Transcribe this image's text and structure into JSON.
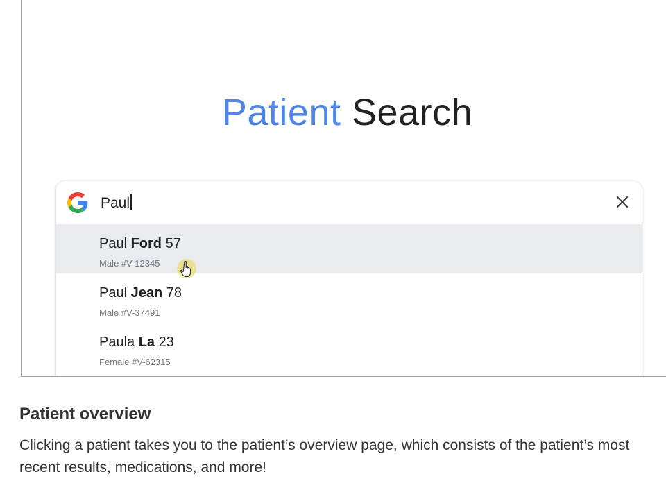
{
  "page": {
    "title_part1": "Patient",
    "title_part2": "Search"
  },
  "search": {
    "query": "Paul",
    "logo_icon": "google-g-icon",
    "clear_icon": "close-icon"
  },
  "results": [
    {
      "first": "Paul",
      "last": "Ford",
      "age": "57",
      "sub": "Male #V-12345",
      "highlighted": true
    },
    {
      "first": "Paul",
      "last": "Jean",
      "age": "78",
      "sub": "Male #V-37491",
      "highlighted": false
    },
    {
      "first": "Paula",
      "last": "La",
      "age": "23",
      "sub": "Female #V-62315",
      "highlighted": false
    }
  ],
  "cursor_icon": "hand-pointer-icon",
  "caption": {
    "heading": "Patient overview",
    "body": "Clicking a patient takes you to the patient’s overview page, which consists of the patient’s most recent results, medications, and more!"
  },
  "colors": {
    "title_blue": "#4f86e8",
    "highlight_bg": "#e9ebee"
  }
}
